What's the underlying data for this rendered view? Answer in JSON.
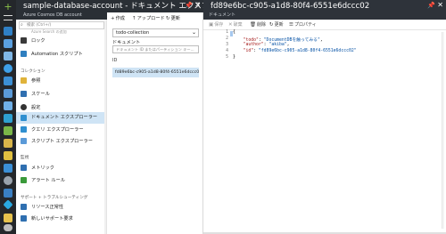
{
  "rail": {
    "icons": [
      "add-icon",
      "menu-icon",
      "dashboard-icon",
      "all-resources-icon",
      "resource-group-icon",
      "globe-icon",
      "database-icon",
      "server-icon",
      "monitor-icon",
      "network-icon",
      "storage-icon",
      "code-icon",
      "key-icon",
      "lightning-icon",
      "settings-icon",
      "shield-icon",
      "diamond-icon",
      "cloud-icon",
      "lock-icon",
      "help-icon"
    ]
  },
  "left_blade": {
    "title": "sample-database-account - ドキュメント エクスプ...",
    "subtitle": "Azure Cosmos DB account",
    "search_placeholder": "検索 (Ctrl+/)",
    "faded_item": "Azure Search の追加",
    "items": [
      {
        "label": "ロック",
        "icon": "lock-icon",
        "color": "#3a3a3a"
      },
      {
        "label": "Automation スクリプト",
        "icon": "automation-script-icon",
        "color": "#2f7fc0"
      }
    ],
    "section_collections": "コレクション",
    "collection_items": [
      {
        "label": "参照",
        "icon": "browse-icon",
        "color": "#e0b33a"
      },
      {
        "label": "スケール",
        "icon": "scale-icon",
        "color": "#2f6fb0"
      },
      {
        "label": "設定",
        "icon": "settings-icon",
        "color": "#333333"
      },
      {
        "label": "ドキュメント エクスプローラー",
        "icon": "document-explorer-icon",
        "color": "#2f8fd0",
        "selected": true
      },
      {
        "label": "クエリ エクスプローラー",
        "icon": "query-explorer-icon",
        "color": "#2f8fd0"
      },
      {
        "label": "スクリプト エクスプローラー",
        "icon": "script-explorer-icon",
        "color": "#5a9ad8"
      }
    ],
    "section_monitoring": "監視",
    "monitoring_items": [
      {
        "label": "メトリック",
        "icon": "metrics-icon",
        "color": "#2f6fb0"
      },
      {
        "label": "アラート ルール",
        "icon": "alert-rules-icon",
        "color": "#3a9a3a"
      }
    ],
    "section_support": "サポート + トラブルシューティング",
    "support_items": [
      {
        "label": "リソース正常性",
        "icon": "resource-health-icon",
        "color": "#2f6fb0"
      },
      {
        "label": "新しいサポート要求",
        "icon": "support-request-icon",
        "color": "#2f6fb0"
      }
    ]
  },
  "middle_blade": {
    "toolbar": {
      "create": "作成",
      "upload": "アップロード",
      "refresh": "更新"
    },
    "collection_select": "todo-collection",
    "documents_label": "ドキュメント",
    "filter_placeholder": "ドキュメント ID またはパーティション キー...",
    "id_header": "ID",
    "selected_document": "fd89e6bc-c905-a1d8-80f4-6551e6dccc02"
  },
  "right_blade": {
    "title": "fd89e6bc-c905-a1d8-80f4-6551e6dccc02",
    "subtitle": "ドキュメント",
    "toolbar": {
      "save": "保存",
      "discard": "破棄",
      "delete": "削除",
      "refresh": "更新",
      "properties": "プロパティ"
    },
    "code": {
      "line_numbers": [
        "1",
        "2",
        "3",
        "4",
        "5"
      ],
      "open_brace": "{",
      "todo_key": "\"todo\"",
      "todo_value": "\"DocumentDBを触ってみる\"",
      "author_key": "\"author\"",
      "author_value": "\"akiba\"",
      "id_key": "\"id\"",
      "id_value": "\"fd89e6bc-c905-a1d8-80f4-6551e6dccc02\"",
      "close_brace": "}"
    }
  },
  "colors": {
    "header_bg": "#2a2f35",
    "rail_bg": "#24272b",
    "selection": "#cfe4f5",
    "accent": "#0072c6"
  }
}
